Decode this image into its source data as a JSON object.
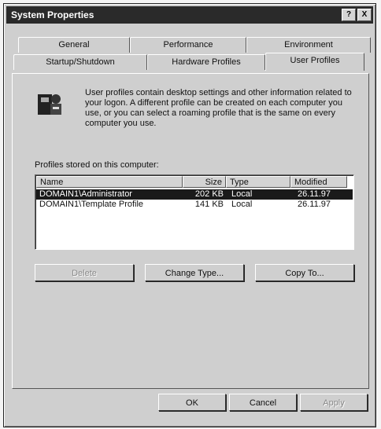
{
  "window": {
    "title": "System Properties",
    "help_glyph": "?",
    "close_glyph": "X"
  },
  "tabs": [
    {
      "label": "General"
    },
    {
      "label": "Performance"
    },
    {
      "label": "Environment"
    },
    {
      "label": "Startup/Shutdown"
    },
    {
      "label": "Hardware Profiles"
    },
    {
      "label": "User Profiles",
      "active": true
    }
  ],
  "panel": {
    "description": "User profiles contain desktop settings and other information related to your logon. A different profile can be created on each computer you use, or you can select a roaming profile that is the same on every computer you use.",
    "list_label": "Profiles stored on this computer:"
  },
  "profiles_table": {
    "columns": [
      "Name",
      "Size",
      "Type",
      "Modified"
    ],
    "rows": [
      {
        "name": "DOMAIN1\\Administrator",
        "size": "202 KB",
        "type": "Local",
        "modified": "26.11.97",
        "selected": true
      },
      {
        "name": "DOMAIN1\\Template Profile",
        "size": "141 KB",
        "type": "Local",
        "modified": "26.11.97",
        "selected": false
      }
    ]
  },
  "actions": {
    "delete": "Delete",
    "change_type": "Change Type...",
    "copy_to": "Copy To..."
  },
  "dialog_buttons": {
    "ok": "OK",
    "cancel": "Cancel",
    "apply": "Apply"
  }
}
